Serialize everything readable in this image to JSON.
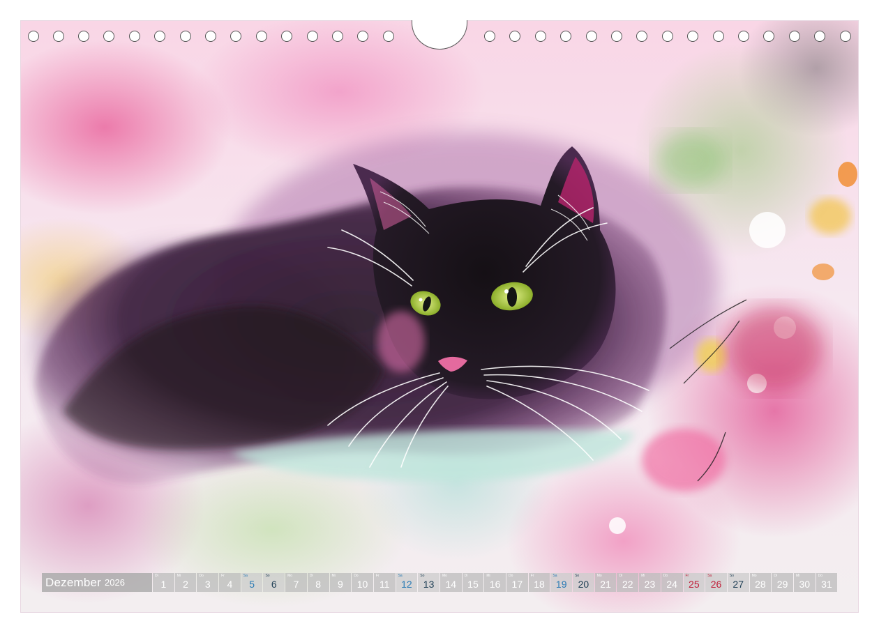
{
  "calendar": {
    "month": "Dezember",
    "year": "2026",
    "days": [
      {
        "num": "1",
        "wd": "Di",
        "type": "normal"
      },
      {
        "num": "2",
        "wd": "Mi",
        "type": "normal"
      },
      {
        "num": "3",
        "wd": "Do",
        "type": "normal"
      },
      {
        "num": "4",
        "wd": "Fr",
        "type": "normal"
      },
      {
        "num": "5",
        "wd": "Sa",
        "type": "sa"
      },
      {
        "num": "6",
        "wd": "So",
        "type": "so"
      },
      {
        "num": "7",
        "wd": "Mo",
        "type": "normal"
      },
      {
        "num": "8",
        "wd": "Di",
        "type": "normal"
      },
      {
        "num": "9",
        "wd": "Mi",
        "type": "normal"
      },
      {
        "num": "10",
        "wd": "Do",
        "type": "normal"
      },
      {
        "num": "11",
        "wd": "Fr",
        "type": "normal"
      },
      {
        "num": "12",
        "wd": "Sa",
        "type": "sa"
      },
      {
        "num": "13",
        "wd": "So",
        "type": "so"
      },
      {
        "num": "14",
        "wd": "Mo",
        "type": "normal"
      },
      {
        "num": "15",
        "wd": "Di",
        "type": "normal"
      },
      {
        "num": "16",
        "wd": "Mi",
        "type": "normal"
      },
      {
        "num": "17",
        "wd": "Do",
        "type": "normal"
      },
      {
        "num": "18",
        "wd": "Fr",
        "type": "normal"
      },
      {
        "num": "19",
        "wd": "Sa",
        "type": "sa"
      },
      {
        "num": "20",
        "wd": "So",
        "type": "so"
      },
      {
        "num": "21",
        "wd": "Mo",
        "type": "normal"
      },
      {
        "num": "22",
        "wd": "Di",
        "type": "normal"
      },
      {
        "num": "23",
        "wd": "Mi",
        "type": "normal"
      },
      {
        "num": "24",
        "wd": "Do",
        "type": "normal"
      },
      {
        "num": "25",
        "wd": "Fr",
        "type": "hol"
      },
      {
        "num": "26",
        "wd": "Sa",
        "type": "hol"
      },
      {
        "num": "27",
        "wd": "So",
        "type": "so"
      },
      {
        "num": "28",
        "wd": "Mo",
        "type": "normal"
      },
      {
        "num": "29",
        "wd": "Di",
        "type": "normal"
      },
      {
        "num": "30",
        "wd": "Mi",
        "type": "normal"
      },
      {
        "num": "31",
        "wd": "Do",
        "type": "normal"
      }
    ]
  },
  "colors": {
    "saturday": "#2a7bb5",
    "sunday": "#1f3f55",
    "holiday": "#c0203a",
    "cat_eye": "#b6d04a"
  },
  "icons": {
    "hole": "binding-hole-icon",
    "hanger": "hanger-notch-icon"
  }
}
